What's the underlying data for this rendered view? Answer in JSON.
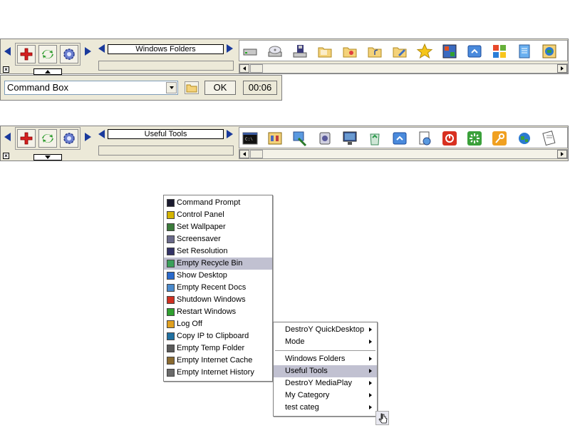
{
  "toolbar1": {
    "category": "Windows Folders",
    "icons": [
      "hard-drive-icon",
      "cd-drive-icon",
      "floppy-drive-icon",
      "folder-shared-icon",
      "folder-docs-icon",
      "folder-music-icon",
      "folder-edit-icon",
      "favorites-star-icon",
      "control-panel-icon",
      "desktop-window-icon",
      "windows-logo-icon",
      "notepad-icon",
      "network-globe-icon"
    ]
  },
  "cmdbox": {
    "value": "Command Box",
    "ok_label": "OK",
    "timer": "00:06"
  },
  "toolbar2": {
    "category": "Useful Tools",
    "icons": [
      "command-prompt-icon",
      "control-panel-icon",
      "wallpaper-icon",
      "screensaver-icon",
      "resolution-icon",
      "recycle-bin-icon",
      "show-desktop-icon",
      "recent-docs-icon",
      "shutdown-icon",
      "restart-icon",
      "logoff-icon",
      "ip-globe-icon",
      "temp-folder-icon"
    ]
  },
  "tools_menu": {
    "items": [
      {
        "label": "Command Prompt",
        "icon": "command-prompt-icon",
        "color": "#1a1a2e"
      },
      {
        "label": "Control Panel",
        "icon": "control-panel-icon",
        "color": "#d4b400"
      },
      {
        "label": "Set Wallpaper",
        "icon": "wallpaper-icon",
        "color": "#3a7a3a"
      },
      {
        "label": "Screensaver",
        "icon": "screensaver-icon",
        "color": "#6a6a8a"
      },
      {
        "label": "Set Resolution",
        "icon": "resolution-icon",
        "color": "#333366"
      },
      {
        "label": "Empty Recycle Bin",
        "icon": "recycle-bin-icon",
        "color": "#3aa05a"
      },
      {
        "label": "Show Desktop",
        "icon": "show-desktop-icon",
        "color": "#2a6acc"
      },
      {
        "label": "Empty Recent Docs",
        "icon": "recent-docs-icon",
        "color": "#4a8acc"
      },
      {
        "label": "Shutdown Windows",
        "icon": "shutdown-icon",
        "color": "#d03020"
      },
      {
        "label": "Restart Windows",
        "icon": "restart-icon",
        "color": "#30a030"
      },
      {
        "label": "Log Off",
        "icon": "logoff-icon",
        "color": "#e0a020"
      },
      {
        "label": "Copy IP to Clipboard",
        "icon": "ip-globe-icon",
        "color": "#2070a0"
      },
      {
        "label": "Empty Temp Folder",
        "icon": "temp-folder-icon",
        "color": "#5a5a5a"
      },
      {
        "label": "Empty Internet Cache",
        "icon": "internet-cache-icon",
        "color": "#8a6a30"
      },
      {
        "label": "Empty Internet History",
        "icon": "internet-history-icon",
        "color": "#6a6a6a"
      }
    ],
    "highlighted": "Empty Recycle Bin"
  },
  "context_menu": {
    "group1": [
      "DestroY QuickDesktop",
      "Mode"
    ],
    "group2": [
      "Windows Folders",
      "Useful Tools",
      "DestroY MediaPlay",
      "My Category",
      "test categ"
    ],
    "highlighted": "Useful Tools"
  }
}
